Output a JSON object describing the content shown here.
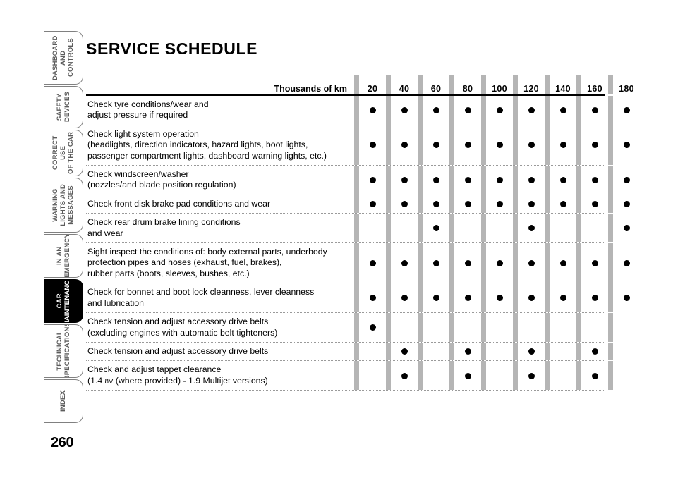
{
  "document": {
    "title": "SERVICE SCHEDULE",
    "page_number": "260"
  },
  "sidebar": {
    "tabs": [
      {
        "label": "DASHBOARD\nAND CONTROLS",
        "active": false
      },
      {
        "label": "SAFETY\nDEVICES",
        "active": false
      },
      {
        "label": "CORRECT USE\nOF THE CAR",
        "active": false
      },
      {
        "label": "WARNING\nLIGHTS AND\nMESSAGES",
        "active": false
      },
      {
        "label": "IN AN\nEMERGENCY",
        "active": false
      },
      {
        "label": "CAR\nMAINTENANCE",
        "active": true
      },
      {
        "label": "TECHNICAL\nSPECIFICATIONS",
        "active": false
      },
      {
        "label": "INDEX",
        "active": false
      }
    ]
  },
  "table": {
    "desc_header": "Thousands of km",
    "columns": [
      "20",
      "40",
      "60",
      "80",
      "100",
      "120",
      "140",
      "160",
      "180"
    ],
    "rows": [
      {
        "lines": [
          "Check tyre conditions/wear and",
          "adjust pressure if required"
        ],
        "marks": [
          true,
          true,
          true,
          true,
          true,
          true,
          true,
          true,
          true
        ]
      },
      {
        "lines": [
          "Check light system operation",
          "(headlights, direction indicators, hazard lights, boot lights,",
          "passenger compartment lights, dashboard warning lights, etc.)"
        ],
        "marks": [
          true,
          true,
          true,
          true,
          true,
          true,
          true,
          true,
          true
        ]
      },
      {
        "lines": [
          "Check windscreen/washer",
          "(nozzles/and blade position regulation)"
        ],
        "marks": [
          true,
          true,
          true,
          true,
          true,
          true,
          true,
          true,
          true
        ]
      },
      {
        "lines": [
          "Check front disk brake pad conditions and wear"
        ],
        "marks": [
          true,
          true,
          true,
          true,
          true,
          true,
          true,
          true,
          true
        ]
      },
      {
        "lines": [
          "Check rear drum brake lining conditions",
          "and wear"
        ],
        "marks": [
          false,
          false,
          true,
          false,
          false,
          true,
          false,
          false,
          true
        ]
      },
      {
        "lines": [
          "Sight inspect the conditions of: body external parts, underbody",
          "protection pipes and hoses (exhaust, fuel, brakes),",
          "rubber parts (boots, sleeves, bushes, etc.)"
        ],
        "marks": [
          true,
          true,
          true,
          true,
          true,
          true,
          true,
          true,
          true
        ]
      },
      {
        "lines": [
          "Check for bonnet and boot lock cleanness, lever cleanness",
          "and lubrication"
        ],
        "marks": [
          true,
          true,
          true,
          true,
          true,
          true,
          true,
          true,
          true
        ]
      },
      {
        "lines": [
          "Check tension and adjust accessory drive belts",
          "(excluding engines with automatic belt tighteners)"
        ],
        "marks": [
          true,
          false,
          false,
          false,
          false,
          false,
          false,
          false,
          false
        ]
      },
      {
        "lines": [
          "Check tension and adjust accessory drive belts"
        ],
        "marks": [
          false,
          true,
          false,
          true,
          false,
          true,
          false,
          true,
          false
        ]
      },
      {
        "lines": [
          "Check and adjust tappet clearance",
          "(1.4 |8V| (where provided) - 1.9 Multijet versions)"
        ],
        "marks": [
          false,
          true,
          false,
          true,
          false,
          true,
          false,
          true,
          false
        ]
      }
    ]
  }
}
